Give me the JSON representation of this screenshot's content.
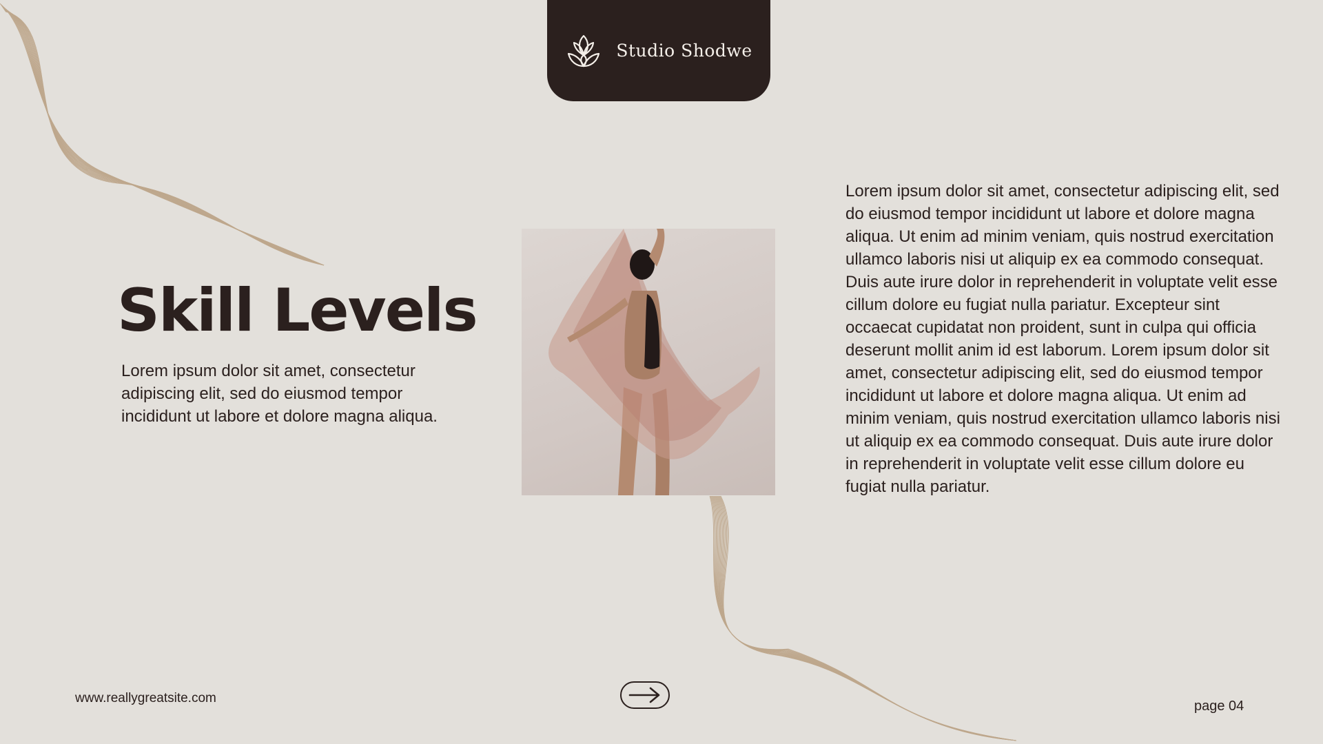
{
  "header": {
    "brand": "Studio Shodwe"
  },
  "main": {
    "title": "Skill Levels",
    "intro": "Lorem ipsum dolor sit amet, consectetur adipiscing elit, sed do eiusmod tempor incididunt ut labore et dolore magna aliqua.",
    "body": "Lorem ipsum dolor sit amet, consectetur adipiscing elit, sed do eiusmod tempor incididunt ut labore et dolore magna aliqua. Ut enim ad minim veniam, quis nostrud exercitation ullamco laboris nisi ut aliquip ex ea commodo consequat. Duis aute irure dolor in reprehenderit in voluptate velit esse cillum dolore eu fugiat nulla pariatur. Excepteur sint occaecat cupidatat non proident, sunt in culpa qui officia deserunt mollit anim id est laborum. Lorem ipsum dolor sit amet, consectetur adipiscing elit, sed do eiusmod tempor incididunt ut labore et dolore magna aliqua. Ut enim ad minim veniam, quis nostrud exercitation ullamco laboris nisi ut aliquip ex ea commodo consequat. Duis aute irure dolor in reprehenderit in voluptate velit esse cillum dolore eu fugiat nulla pariatur."
  },
  "footer": {
    "website": "www.reallygreatsite.com",
    "page": "page 04"
  },
  "icons": {
    "logo": "lotus-icon",
    "next": "arrow-right-icon"
  },
  "colors": {
    "background": "#e3e0db",
    "dark": "#2b201e",
    "accent": "#b59a7a",
    "fabric": "#c99a8c"
  }
}
